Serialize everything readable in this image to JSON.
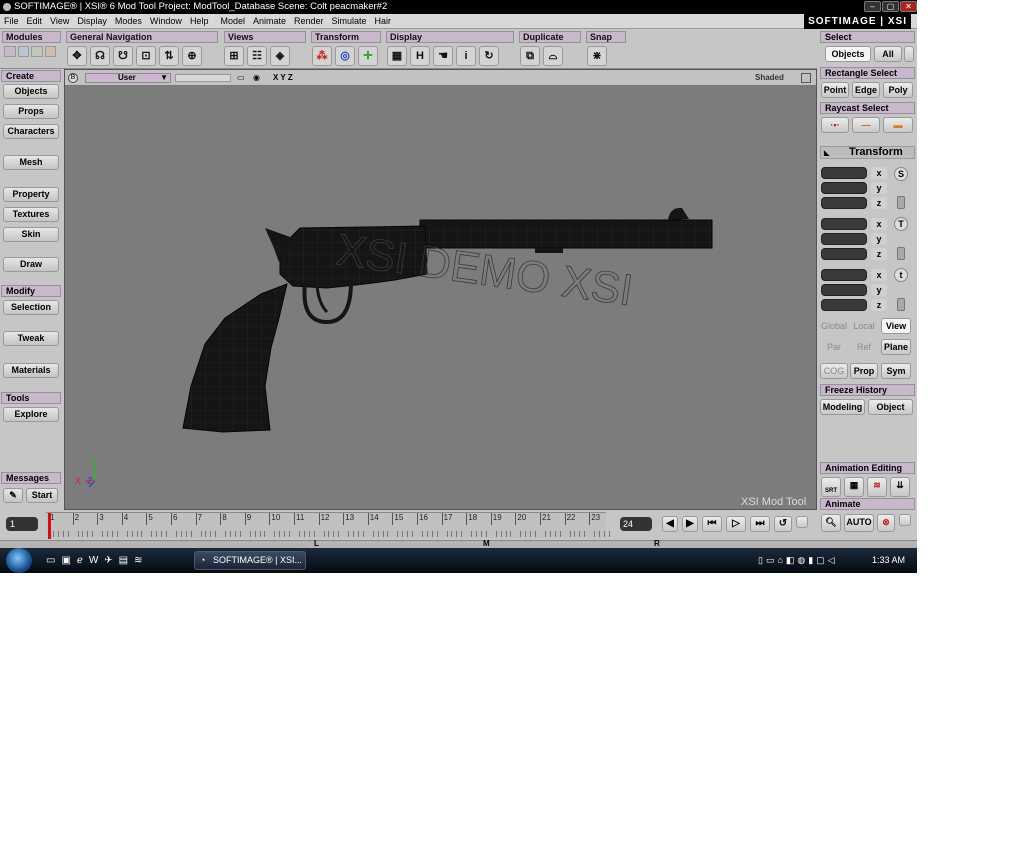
{
  "window": {
    "title": "SOFTIMAGE® | XSI® 6 Mod Tool Project: ModTool_Database    Scene: Colt peacmaker#2",
    "brand": "SOFTIMAGE | XSI",
    "controls": [
      "–",
      "▢",
      "✕"
    ]
  },
  "menu": [
    "File",
    "Edit",
    "View",
    "Display",
    "Modes",
    "Window",
    "Help",
    "Model",
    "Animate",
    "Render",
    "Simulate",
    "Hair"
  ],
  "toolbar": {
    "modules": "Modules",
    "general_navigation": "General Navigation",
    "views": "Views",
    "transform": "Transform",
    "display": "Display",
    "duplicate": "Duplicate",
    "snap": "Snap",
    "display_h": "H",
    "display_i": "i"
  },
  "left_panel": {
    "create_header": "Create",
    "create_items": [
      "Objects",
      "Props",
      "Characters",
      "Mesh",
      "Property",
      "Textures",
      "Skin",
      "Draw"
    ],
    "modify_header": "Modify",
    "modify_items": [
      "Selection",
      "Tweak",
      "Materials"
    ],
    "tools_header": "Tools",
    "tools_items": [
      "Explore"
    ],
    "messages_header": "Messages",
    "start_label": "Start"
  },
  "viewport": {
    "camera": "User",
    "axes_label": "X Y Z",
    "mode": "Shaded",
    "watermark": "XSI Mod Tool",
    "b_button": "B",
    "gizmo": {
      "x": "X",
      "y": "Y",
      "z": "Z"
    }
  },
  "right_panel": {
    "select_header": "Select",
    "objects": "Objects",
    "all": "All",
    "rectangle_select": "Rectangle Select",
    "point": "Point",
    "edge": "Edge",
    "poly": "Poly",
    "raycast_select": "Raycast Select",
    "transform_header": "Transform",
    "axes": [
      "x",
      "y",
      "z"
    ],
    "groups": [
      "S",
      "T",
      "t"
    ],
    "global": "Global",
    "local": "Local",
    "view": "View",
    "par": "Par",
    "ref": "Ref",
    "plane": "Plane",
    "cog": "COG",
    "prop": "Prop",
    "sym": "Sym",
    "freeze_history": "Freeze History",
    "modeling": "Modeling",
    "object": "Object",
    "animation_editing": "Animation Editing",
    "srt": "SRT",
    "animate_header": "Animate",
    "auto": "AUTO"
  },
  "timeline": {
    "current_frame": "1",
    "end_frame": "24",
    "ticks": [
      "1",
      "2",
      "3",
      "4",
      "5",
      "6",
      "7",
      "8",
      "9",
      "10",
      "11",
      "12",
      "13",
      "14",
      "15",
      "16",
      "17",
      "18",
      "19",
      "20",
      "21",
      "22",
      "23"
    ],
    "lmr": [
      "L",
      "M",
      "R"
    ]
  },
  "taskbar": {
    "task_label": "SOFTIMAGE® | XSI...",
    "clock": "1:33 AM"
  },
  "colors": {
    "header_lilac": "#c9b7cc",
    "viewport_gray": "#7c7c7c",
    "model_black": "#151515",
    "frame_marker_red": "#d01010"
  }
}
